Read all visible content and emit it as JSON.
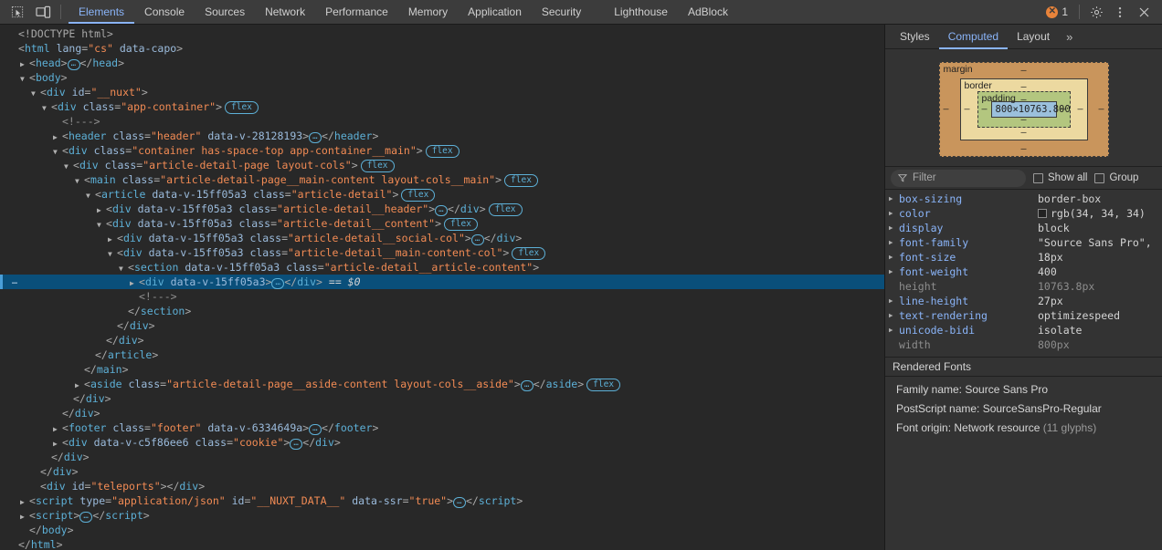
{
  "toolbar": {
    "inspect_icon": "inspect-cursor-icon",
    "device_icon": "device-toolbar-icon",
    "tabs": [
      {
        "label": "Elements",
        "active": true
      },
      {
        "label": "Console",
        "active": false
      },
      {
        "label": "Sources",
        "active": false
      },
      {
        "label": "Network",
        "active": false
      },
      {
        "label": "Performance",
        "active": false
      },
      {
        "label": "Memory",
        "active": false
      },
      {
        "label": "Application",
        "active": false
      },
      {
        "label": "Security",
        "active": false
      },
      {
        "label": "Lighthouse",
        "active": false
      },
      {
        "label": "AdBlock",
        "active": false
      }
    ],
    "error_count": "1",
    "settings_icon": "gear-icon",
    "more_icon": "kebab-menu-icon",
    "close_icon": "close-icon"
  },
  "dom": {
    "lines": [
      {
        "indent": 0,
        "tri": "blank",
        "html": "<span class=\"doct\">&lt;!DOCTYPE html&gt;</span>"
      },
      {
        "indent": 0,
        "tri": "blank",
        "html": "<span class=\"punct\">&lt;</span><span class=\"tag\">html</span> <span class=\"attr\">lang</span><span class=\"punct\">=</span><span class=\"val\">\"cs\"</span> <span class=\"attr\">data-capo</span><span class=\"punct\">&gt;</span>"
      },
      {
        "indent": 1,
        "tri": "closed",
        "html": "<span class=\"punct\">&lt;</span><span class=\"tag\">head</span><span class=\"punct\">&gt;</span><span class=\"dots\">…</span><span class=\"punct\">&lt;/</span><span class=\"tag\">head</span><span class=\"punct\">&gt;</span>"
      },
      {
        "indent": 1,
        "tri": "open",
        "html": "<span class=\"punct\">&lt;</span><span class=\"tag\">body</span><span class=\"punct\">&gt;</span>"
      },
      {
        "indent": 2,
        "tri": "open",
        "html": "<span class=\"punct\">&lt;</span><span class=\"tag\">div</span> <span class=\"attr\">id</span><span class=\"punct\">=</span><span class=\"val\">\"__nuxt\"</span><span class=\"punct\">&gt;</span>"
      },
      {
        "indent": 3,
        "tri": "open",
        "html": "<span class=\"punct\">&lt;</span><span class=\"tag\">div</span> <span class=\"attr\">class</span><span class=\"punct\">=</span><span class=\"val\">\"app-container\"</span><span class=\"punct\">&gt;</span><span class=\"badge-flex\">flex</span>"
      },
      {
        "indent": 4,
        "tri": "blank",
        "html": "<span class=\"cmt\">&lt;!---&gt;</span>"
      },
      {
        "indent": 4,
        "tri": "closed",
        "html": "<span class=\"punct\">&lt;</span><span class=\"tag\">header</span> <span class=\"attr\">class</span><span class=\"punct\">=</span><span class=\"val\">\"header\"</span> <span class=\"attr\">data-v-28128193</span><span class=\"punct\">&gt;</span><span class=\"dots\">…</span><span class=\"punct\">&lt;/</span><span class=\"tag\">header</span><span class=\"punct\">&gt;</span>"
      },
      {
        "indent": 4,
        "tri": "open",
        "html": "<span class=\"punct\">&lt;</span><span class=\"tag\">div</span> <span class=\"attr\">class</span><span class=\"punct\">=</span><span class=\"val\">\"container has-space-top app-container__main\"</span><span class=\"punct\">&gt;</span><span class=\"badge-flex\">flex</span>"
      },
      {
        "indent": 5,
        "tri": "open",
        "html": "<span class=\"punct\">&lt;</span><span class=\"tag\">div</span> <span class=\"attr\">class</span><span class=\"punct\">=</span><span class=\"val\">\"article-detail-page layout-cols\"</span><span class=\"punct\">&gt;</span><span class=\"badge-flex\">flex</span>"
      },
      {
        "indent": 6,
        "tri": "open",
        "html": "<span class=\"punct\">&lt;</span><span class=\"tag\">main</span> <span class=\"attr\">class</span><span class=\"punct\">=</span><span class=\"val\">\"article-detail-page__main-content layout-cols__main\"</span><span class=\"punct\">&gt;</span><span class=\"badge-flex\">flex</span>"
      },
      {
        "indent": 7,
        "tri": "open",
        "html": "<span class=\"punct\">&lt;</span><span class=\"tag\">article</span> <span class=\"attr\">data-v-15ff05a3</span> <span class=\"attr\">class</span><span class=\"punct\">=</span><span class=\"val\">\"article-detail\"</span><span class=\"punct\">&gt;</span><span class=\"badge-flex\">flex</span>"
      },
      {
        "indent": 8,
        "tri": "closed",
        "html": "<span class=\"punct\">&lt;</span><span class=\"tag\">div</span> <span class=\"attr\">data-v-15ff05a3</span> <span class=\"attr\">class</span><span class=\"punct\">=</span><span class=\"val\">\"article-detail__header\"</span><span class=\"punct\">&gt;</span><span class=\"dots\">…</span><span class=\"punct\">&lt;/</span><span class=\"tag\">div</span><span class=\"punct\">&gt;</span><span class=\"badge-flex\">flex</span>"
      },
      {
        "indent": 8,
        "tri": "open",
        "html": "<span class=\"punct\">&lt;</span><span class=\"tag\">div</span> <span class=\"attr\">data-v-15ff05a3</span> <span class=\"attr\">class</span><span class=\"punct\">=</span><span class=\"val\">\"article-detail__content\"</span><span class=\"punct\">&gt;</span><span class=\"badge-flex\">flex</span>"
      },
      {
        "indent": 9,
        "tri": "closed",
        "html": "<span class=\"punct\">&lt;</span><span class=\"tag\">div</span> <span class=\"attr\">data-v-15ff05a3</span> <span class=\"attr\">class</span><span class=\"punct\">=</span><span class=\"val\">\"article-detail__social-col\"</span><span class=\"punct\">&gt;</span><span class=\"dots\">…</span><span class=\"punct\">&lt;/</span><span class=\"tag\">div</span><span class=\"punct\">&gt;</span>"
      },
      {
        "indent": 9,
        "tri": "open",
        "html": "<span class=\"punct\">&lt;</span><span class=\"tag\">div</span> <span class=\"attr\">data-v-15ff05a3</span> <span class=\"attr\">class</span><span class=\"punct\">=</span><span class=\"val\">\"article-detail__main-content-col\"</span><span class=\"punct\">&gt;</span><span class=\"badge-flex\">flex</span>"
      },
      {
        "indent": 10,
        "tri": "open",
        "html": "<span class=\"punct\">&lt;</span><span class=\"tag\">section</span> <span class=\"attr\">data-v-15ff05a3</span> <span class=\"attr\">class</span><span class=\"punct\">=</span><span class=\"val\">\"article-detail__article-content\"</span><span class=\"punct\">&gt;</span>"
      },
      {
        "indent": 11,
        "tri": "closed",
        "selected": true,
        "html": "<span class=\"punct\">&lt;</span><span class=\"tag\">div</span> <span class=\"attr\">data-v-15ff05a3</span><span class=\"punct\">&gt;</span><span class=\"dots\">…</span><span class=\"punct\">&lt;/</span><span class=\"tag\">div</span><span class=\"punct\">&gt;</span> <span class=\"dollar\">== $0</span>"
      },
      {
        "indent": 11,
        "tri": "blank",
        "html": "<span class=\"cmt\">&lt;!---&gt;</span>"
      },
      {
        "indent": 10,
        "tri": "blank",
        "html": "<span class=\"punct\">&lt;/</span><span class=\"tag\">section</span><span class=\"punct\">&gt;</span>"
      },
      {
        "indent": 9,
        "tri": "blank",
        "html": "<span class=\"punct\">&lt;/</span><span class=\"tag\">div</span><span class=\"punct\">&gt;</span>"
      },
      {
        "indent": 8,
        "tri": "blank",
        "html": "<span class=\"punct\">&lt;/</span><span class=\"tag\">div</span><span class=\"punct\">&gt;</span>"
      },
      {
        "indent": 7,
        "tri": "blank",
        "html": "<span class=\"punct\">&lt;/</span><span class=\"tag\">article</span><span class=\"punct\">&gt;</span>"
      },
      {
        "indent": 6,
        "tri": "blank",
        "html": "<span class=\"punct\">&lt;/</span><span class=\"tag\">main</span><span class=\"punct\">&gt;</span>"
      },
      {
        "indent": 6,
        "tri": "closed",
        "html": "<span class=\"punct\">&lt;</span><span class=\"tag\">aside</span> <span class=\"attr\">class</span><span class=\"punct\">=</span><span class=\"val\">\"article-detail-page__aside-content layout-cols__aside\"</span><span class=\"punct\">&gt;</span><span class=\"dots\">…</span><span class=\"punct\">&lt;/</span><span class=\"tag\">aside</span><span class=\"punct\">&gt;</span><span class=\"badge-flex\">flex</span>"
      },
      {
        "indent": 5,
        "tri": "blank",
        "html": "<span class=\"punct\">&lt;/</span><span class=\"tag\">div</span><span class=\"punct\">&gt;</span>"
      },
      {
        "indent": 4,
        "tri": "blank",
        "html": "<span class=\"punct\">&lt;/</span><span class=\"tag\">div</span><span class=\"punct\">&gt;</span>"
      },
      {
        "indent": 4,
        "tri": "closed",
        "html": "<span class=\"punct\">&lt;</span><span class=\"tag\">footer</span> <span class=\"attr\">class</span><span class=\"punct\">=</span><span class=\"val\">\"footer\"</span> <span class=\"attr\">data-v-6334649a</span><span class=\"punct\">&gt;</span><span class=\"dots\">…</span><span class=\"punct\">&lt;/</span><span class=\"tag\">footer</span><span class=\"punct\">&gt;</span>"
      },
      {
        "indent": 4,
        "tri": "closed",
        "html": "<span class=\"punct\">&lt;</span><span class=\"tag\">div</span> <span class=\"attr\">data-v-c5f86ee6</span> <span class=\"attr\">class</span><span class=\"punct\">=</span><span class=\"val\">\"cookie\"</span><span class=\"punct\">&gt;</span><span class=\"dots\">…</span><span class=\"punct\">&lt;/</span><span class=\"tag\">div</span><span class=\"punct\">&gt;</span>"
      },
      {
        "indent": 3,
        "tri": "blank",
        "html": "<span class=\"punct\">&lt;/</span><span class=\"tag\">div</span><span class=\"punct\">&gt;</span>"
      },
      {
        "indent": 2,
        "tri": "blank",
        "html": "<span class=\"punct\">&lt;/</span><span class=\"tag\">div</span><span class=\"punct\">&gt;</span>"
      },
      {
        "indent": 2,
        "tri": "blank",
        "html": "<span class=\"punct\">&lt;</span><span class=\"tag\">div</span> <span class=\"attr\">id</span><span class=\"punct\">=</span><span class=\"val\">\"teleports\"</span><span class=\"punct\">&gt;&lt;/</span><span class=\"tag\">div</span><span class=\"punct\">&gt;</span>"
      },
      {
        "indent": 1,
        "tri": "closed",
        "html": "<span class=\"punct\">&lt;</span><span class=\"tag\">script</span> <span class=\"attr\">type</span><span class=\"punct\">=</span><span class=\"val\">\"application/json\"</span> <span class=\"attr\">id</span><span class=\"punct\">=</span><span class=\"val\">\"__NUXT_DATA__\"</span> <span class=\"attr\">data-ssr</span><span class=\"punct\">=</span><span class=\"val\">\"true\"</span><span class=\"punct\">&gt;</span><span class=\"dots\">…</span><span class=\"punct\">&lt;/</span><span class=\"tag\">script</span><span class=\"punct\">&gt;</span>"
      },
      {
        "indent": 1,
        "tri": "closed",
        "html": "<span class=\"punct\">&lt;</span><span class=\"tag\">script</span><span class=\"punct\">&gt;</span><span class=\"dots\">…</span><span class=\"punct\">&lt;/</span><span class=\"tag\">script</span><span class=\"punct\">&gt;</span>"
      },
      {
        "indent": 1,
        "tri": "blank",
        "html": "<span class=\"punct\">&lt;/</span><span class=\"tag\">body</span><span class=\"punct\">&gt;</span>"
      },
      {
        "indent": 0,
        "tri": "blank",
        "html": "<span class=\"punct\">&lt;/</span><span class=\"tag\">html</span><span class=\"punct\">&gt;</span>"
      }
    ]
  },
  "sidebar": {
    "tabs": [
      {
        "label": "Styles",
        "active": false
      },
      {
        "label": "Computed",
        "active": true
      },
      {
        "label": "Layout",
        "active": false
      }
    ],
    "more_tabs_icon": "double-chevron-right-icon",
    "box_model": {
      "margin_label": "margin",
      "border_label": "border",
      "padding_label": "padding",
      "content": "800×10763.800",
      "margin_top": "–",
      "margin_right": "–",
      "margin_bottom": "–",
      "margin_left": "–",
      "border_top": "–",
      "border_right": "–",
      "border_bottom": "–",
      "border_left": "–",
      "padding_top": "–",
      "padding_right": "–",
      "padding_bottom": "–",
      "padding_left": "–",
      "colors": {
        "margin": "#c9955c",
        "border": "#ecd9a0",
        "padding": "#b3c67f",
        "content": "#9bc0dc"
      }
    },
    "filter": {
      "icon": "filter-funnel-icon",
      "placeholder": "Filter",
      "value": "",
      "show_all_label": "Show all",
      "show_all_checked": false,
      "group_label": "Group",
      "group_checked": false
    },
    "computed_properties": [
      {
        "name": "box-sizing",
        "value": "border-box",
        "expandable": true,
        "dim": false,
        "swatch": null
      },
      {
        "name": "color",
        "value": "rgb(34, 34, 34)",
        "expandable": true,
        "dim": false,
        "swatch": "#222222"
      },
      {
        "name": "display",
        "value": "block",
        "expandable": true,
        "dim": false,
        "swatch": null
      },
      {
        "name": "font-family",
        "value": "\"Source Sans Pro\",",
        "expandable": true,
        "dim": false,
        "swatch": null
      },
      {
        "name": "font-size",
        "value": "18px",
        "expandable": true,
        "dim": false,
        "swatch": null
      },
      {
        "name": "font-weight",
        "value": "400",
        "expandable": true,
        "dim": false,
        "swatch": null
      },
      {
        "name": "height",
        "value": "10763.8px",
        "expandable": false,
        "dim": true,
        "swatch": null
      },
      {
        "name": "line-height",
        "value": "27px",
        "expandable": true,
        "dim": false,
        "swatch": null
      },
      {
        "name": "text-rendering",
        "value": "optimizespeed",
        "expandable": true,
        "dim": false,
        "swatch": null
      },
      {
        "name": "unicode-bidi",
        "value": "isolate",
        "expandable": true,
        "dim": false,
        "swatch": null
      },
      {
        "name": "width",
        "value": "800px",
        "expandable": false,
        "dim": true,
        "swatch": null
      }
    ],
    "rendered_fonts": {
      "title": "Rendered Fonts",
      "lines": [
        {
          "text": "Family name: Source Sans Pro",
          "muted": ""
        },
        {
          "text": "PostScript name: SourceSansPro-Regular",
          "muted": ""
        },
        {
          "text": "Font origin: Network resource ",
          "muted": "(11 glyphs)"
        }
      ]
    }
  }
}
